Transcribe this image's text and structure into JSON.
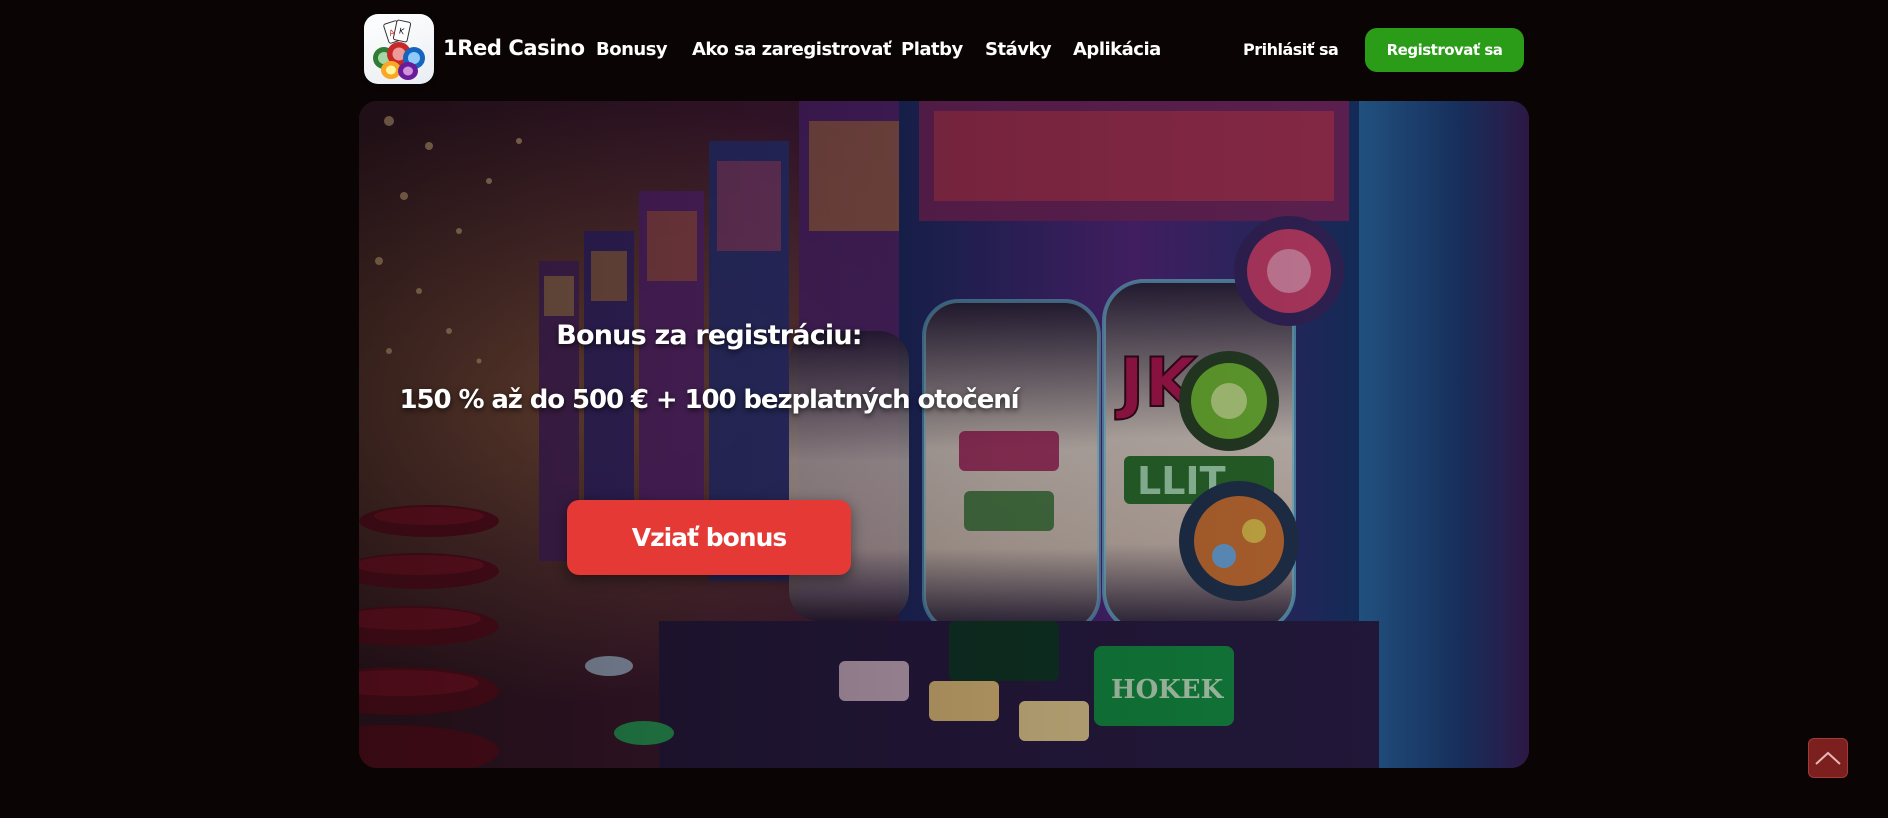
{
  "header": {
    "brand": "1Red Casino",
    "nav": [
      {
        "label": "Bonusy"
      },
      {
        "label": "Ako sa zaregistrovať"
      },
      {
        "label": "Platby"
      },
      {
        "label": "Stávky"
      },
      {
        "label": "Aplikácia"
      }
    ],
    "login_label": "Prihlásiť sa",
    "register_label": "Registrovať sa"
  },
  "hero": {
    "title": "Bonus za registráciu:",
    "offer": "150 % až do 500 € + 100 bezplatných otočení",
    "cta_label": "Vziať bonus",
    "reel_labels": [
      "JKG",
      "LLIT",
      "HOKEK"
    ]
  },
  "colors": {
    "background": "#0b0405",
    "register_green": "#2a9c18",
    "cta_red": "#e53935",
    "to_top": "#7c1f1f"
  },
  "icons": {
    "logo": "casino-chips-logo-icon",
    "to_top": "chevron-up-icon"
  }
}
